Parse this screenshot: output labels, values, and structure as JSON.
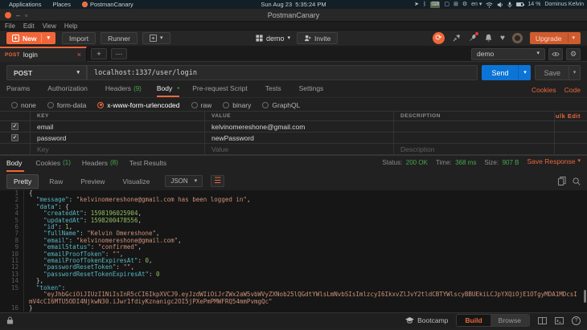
{
  "icons": {
    "caret": "▾",
    "plus": "+",
    "close": "×",
    "more": "⋯",
    "check": "✓",
    "sync": "⟳",
    "heart": "♥",
    "gear": "⚙",
    "grid": "⊞",
    "keyboard": "⌨",
    "bluetooth": "ᛒ",
    "paperplane": "➤",
    "window": "▢",
    "dots": "•••",
    "dot": "●",
    "wrap": "☰",
    "minus": "–",
    "square": "▫",
    "question": "?"
  },
  "system_bar": {
    "applications": "Applications",
    "places": "Places",
    "app": "PostmanCanary",
    "clock": "Sun Aug 23  5:35:24 PM",
    "lang": "en",
    "battery": "14 %",
    "user": "Dominus Kelvin"
  },
  "window": {
    "title": "PostmanCanary",
    "menus": [
      {
        "label": "File"
      },
      {
        "label": "Edit"
      },
      {
        "label": "View"
      },
      {
        "label": "Help"
      }
    ]
  },
  "toolbar": {
    "new": "New",
    "import": "Import",
    "runner": "Runner",
    "workspace": "demo",
    "invite": "Invite",
    "upgrade": "Upgrade"
  },
  "tabbar": {
    "tab_method": "POST",
    "tab_title": "login",
    "env": "demo"
  },
  "request": {
    "method": "POST",
    "url": "localhost:1337/user/login",
    "send": "Send",
    "save": "Save",
    "cookies": "Cookies",
    "code": "Code",
    "tabs": [
      {
        "label": "Params",
        "count": "",
        "cls": "",
        "dot": ""
      },
      {
        "label": "Authorization",
        "count": "",
        "cls": "",
        "dot": ""
      },
      {
        "label": "Headers",
        "count": "(9)",
        "cls": "",
        "dot": ""
      },
      {
        "label": "Body",
        "count": "",
        "cls": "active",
        "dot": "●"
      },
      {
        "label": "Pre-request Script",
        "count": "",
        "cls": "",
        "dot": ""
      },
      {
        "label": "Tests",
        "count": "",
        "cls": "",
        "dot": ""
      },
      {
        "label": "Settings",
        "count": "",
        "cls": "",
        "dot": ""
      }
    ],
    "body_modes": [
      {
        "label": "none",
        "cls": ""
      },
      {
        "label": "form-data",
        "cls": ""
      },
      {
        "label": "x-www-form-urlencoded",
        "cls": "on"
      },
      {
        "label": "raw",
        "cls": ""
      },
      {
        "label": "binary",
        "cls": ""
      },
      {
        "label": "GraphQL",
        "cls": ""
      }
    ],
    "table": {
      "headers": {
        "key": "KEY",
        "value": "VALUE",
        "description": "DESCRIPTION"
      },
      "bulk_edit": "Bulk Edit",
      "rows": [
        {
          "key": "email",
          "value": "kelvinomereshone@gmail.com",
          "desc": ""
        },
        {
          "key": "password",
          "value": "newPassword",
          "desc": ""
        }
      ],
      "placeholder": {
        "key": "Key",
        "value": "Value",
        "desc": "Description"
      }
    }
  },
  "response": {
    "tabs": [
      {
        "label": "Body",
        "count": "",
        "cls": "active"
      },
      {
        "label": "Cookies",
        "count": "(1)",
        "cls": ""
      },
      {
        "label": "Headers",
        "count": "(8)",
        "cls": ""
      },
      {
        "label": "Test Results",
        "count": "",
        "cls": ""
      }
    ],
    "status_label": "Status:",
    "status": "200 OK",
    "time_label": "Time:",
    "time": "368 ms",
    "size_label": "Size:",
    "size": "907 B",
    "save_response": "Save Response",
    "views": [
      {
        "label": "Pretty",
        "cls": "active"
      },
      {
        "label": "Raw",
        "cls": ""
      },
      {
        "label": "Preview",
        "cls": ""
      },
      {
        "label": "Visualize",
        "cls": ""
      }
    ],
    "language": "JSON"
  },
  "code": {
    "lines": [
      {
        "n": "1",
        "seg": [
          {
            "c": "p",
            "x": "{"
          }
        ]
      },
      {
        "n": "2",
        "seg": [
          {
            "c": "k",
            "x": "  \"message\""
          },
          {
            "c": "p",
            "x": ": "
          },
          {
            "c": "s",
            "x": "\"kelvinomereshone@gmail.com has been logged in\""
          },
          {
            "c": "p",
            "x": ","
          }
        ]
      },
      {
        "n": "3",
        "seg": [
          {
            "c": "k",
            "x": "  \"data\""
          },
          {
            "c": "p",
            "x": ": {"
          }
        ]
      },
      {
        "n": "4",
        "seg": [
          {
            "c": "k",
            "x": "    \"createdAt\""
          },
          {
            "c": "p",
            "x": ": "
          },
          {
            "c": "n",
            "x": "1598196025904"
          },
          {
            "c": "p",
            "x": ","
          }
        ]
      },
      {
        "n": "5",
        "seg": [
          {
            "c": "k",
            "x": "    \"updatedAt\""
          },
          {
            "c": "p",
            "x": ": "
          },
          {
            "c": "n",
            "x": "1598200478556"
          },
          {
            "c": "p",
            "x": ","
          }
        ]
      },
      {
        "n": "6",
        "seg": [
          {
            "c": "k",
            "x": "    \"id\""
          },
          {
            "c": "p",
            "x": ": "
          },
          {
            "c": "n",
            "x": "1"
          },
          {
            "c": "p",
            "x": ","
          }
        ]
      },
      {
        "n": "7",
        "seg": [
          {
            "c": "k",
            "x": "    \"fullName\""
          },
          {
            "c": "p",
            "x": ": "
          },
          {
            "c": "s",
            "x": "\"Kelvin Omereshone\""
          },
          {
            "c": "p",
            "x": ","
          }
        ]
      },
      {
        "n": "8",
        "seg": [
          {
            "c": "k",
            "x": "    \"email\""
          },
          {
            "c": "p",
            "x": ": "
          },
          {
            "c": "s",
            "x": "\"kelvinomereshone@gmail.com\""
          },
          {
            "c": "p",
            "x": ","
          }
        ]
      },
      {
        "n": "9",
        "seg": [
          {
            "c": "k",
            "x": "    \"emailStatus\""
          },
          {
            "c": "p",
            "x": ": "
          },
          {
            "c": "s",
            "x": "\"confirmed\""
          },
          {
            "c": "p",
            "x": ","
          }
        ]
      },
      {
        "n": "10",
        "seg": [
          {
            "c": "k",
            "x": "    \"emailProofToken\""
          },
          {
            "c": "p",
            "x": ": "
          },
          {
            "c": "s",
            "x": "\"\""
          },
          {
            "c": "p",
            "x": ","
          }
        ]
      },
      {
        "n": "11",
        "seg": [
          {
            "c": "k",
            "x": "    \"emailProofTokenExpiresAt\""
          },
          {
            "c": "p",
            "x": ": "
          },
          {
            "c": "n",
            "x": "0"
          },
          {
            "c": "p",
            "x": ","
          }
        ]
      },
      {
        "n": "12",
        "seg": [
          {
            "c": "k",
            "x": "    \"passwordResetToken\""
          },
          {
            "c": "p",
            "x": ": "
          },
          {
            "c": "s",
            "x": "\"\""
          },
          {
            "c": "p",
            "x": ","
          }
        ]
      },
      {
        "n": "13",
        "seg": [
          {
            "c": "k",
            "x": "    \"passwordResetTokenExpiresAt\""
          },
          {
            "c": "p",
            "x": ": "
          },
          {
            "c": "n",
            "x": "0"
          }
        ]
      },
      {
        "n": "14",
        "seg": [
          {
            "c": "p",
            "x": "  },"
          }
        ]
      },
      {
        "n": "15",
        "seg": [
          {
            "c": "k",
            "x": "  \"token\""
          },
          {
            "c": "p",
            "x": ":\n    "
          },
          {
            "c": "s",
            "x": "\"eyJhbGciOiJIUzI1NiIsInR5cCI6IkpXVCJ9.eyJzdWIiOiJrZWx2aW5vbWVyZXNob25lQGdtYWlsLmNvbSIsImlzcyI6IkxvZlJvY2tldCBTYWlscyBBUEkiLCJpYXQiOjE1OTgyMDA1MDcsImV4cCI6MTU5ODI4NjkwN30.iJwr1fdiyKznanigc2OI5jPXePmPMWFRQ54mmPvmgQc\""
          }
        ]
      },
      {
        "n": "16",
        "seg": [
          {
            "c": "p",
            "x": "}"
          }
        ]
      }
    ]
  },
  "footer": {
    "bootcamp": "Bootcamp",
    "build": "Build",
    "browse": "Browse"
  }
}
